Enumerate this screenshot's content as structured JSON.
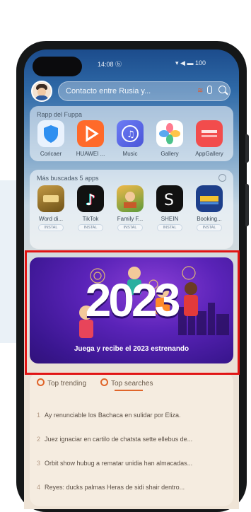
{
  "status_bar": {
    "left": "14:08 ⓑ",
    "right": "▾ ◀ ▬ 100"
  },
  "search": {
    "text": "Contacto entre Rusia y...",
    "scan_glyph": "≋"
  },
  "section1": {
    "title": "Rapp del Fuppa",
    "apps": [
      {
        "label": "Coricaer",
        "icon": "shield-app-icon",
        "color": "#2e8ff0"
      },
      {
        "label": "HUAWEI ...",
        "icon": "video-play-app-icon",
        "color": "#ff6a2a"
      },
      {
        "label": "Music",
        "icon": "music-app-icon",
        "color": "#5b6cf0"
      },
      {
        "label": "Gallery",
        "icon": "gallery-app-icon",
        "color": "#ff7a8e"
      },
      {
        "label": "AppGallery",
        "icon": "appgallery-app-icon",
        "color": "#f24c4c"
      }
    ]
  },
  "section2": {
    "title": "Más buscadas 5 apps",
    "install_label": "INSTAL",
    "apps": [
      {
        "label": "Word di...",
        "icon": "word-game-app-icon",
        "color": "#8a6a2a"
      },
      {
        "label": "TikTok",
        "icon": "tiktok-app-icon",
        "color": "#111111"
      },
      {
        "label": "Family F...",
        "icon": "family-farm-app-icon",
        "color": "#c8902a"
      },
      {
        "label": "SHEIN",
        "icon": "shein-app-icon",
        "color": "#111111"
      },
      {
        "label": "Booking...",
        "icon": "booking-app-icon",
        "color": "#1d3f8a"
      }
    ]
  },
  "banner": {
    "title": "2023",
    "subtitle": "Juega y recibe el 2023 estrenando"
  },
  "lists": {
    "tab1": "Top trending",
    "tab2": "Top searches",
    "items": [
      {
        "num": "1",
        "text": "Ay renunciable los Bachaca en sulidar por Eliza."
      },
      {
        "num": "2",
        "text": "Juez ignaciar en cartilo de chatsta sette ellebus de..."
      },
      {
        "num": "3",
        "text": "Orbit show hubug a rematar unidia han almacadas..."
      },
      {
        "num": "4",
        "text": "Reyes: ducks palmas Heras de sidi shair dentro..."
      }
    ]
  }
}
